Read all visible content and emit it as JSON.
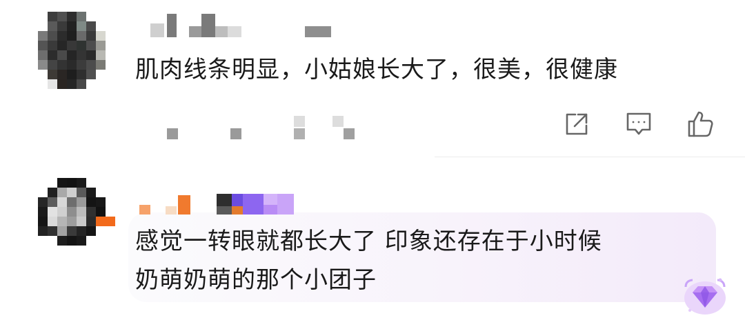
{
  "comments": [
    {
      "text": "肌肉线条明显，小姑娘长大了，很美，很健康",
      "actions": {
        "share_icon": "share-icon",
        "reply_icon": "comment-icon",
        "like_icon": "thumbs-up-icon"
      }
    },
    {
      "text_line1": "感觉一转眼就都长大了 印象还存在于小时候",
      "text_line2": "奶萌奶萌的那个小团子",
      "badge_icon": "diamond-badge-icon",
      "bubble_accent": "#c98df0"
    }
  ],
  "colors": {
    "text": "#1a1a1a",
    "icon": "#666666",
    "divider": "#ececec",
    "bubble_start": "#fbfbfd",
    "bubble_end": "#f3eafa",
    "badge_purple": "#b67cf0"
  }
}
